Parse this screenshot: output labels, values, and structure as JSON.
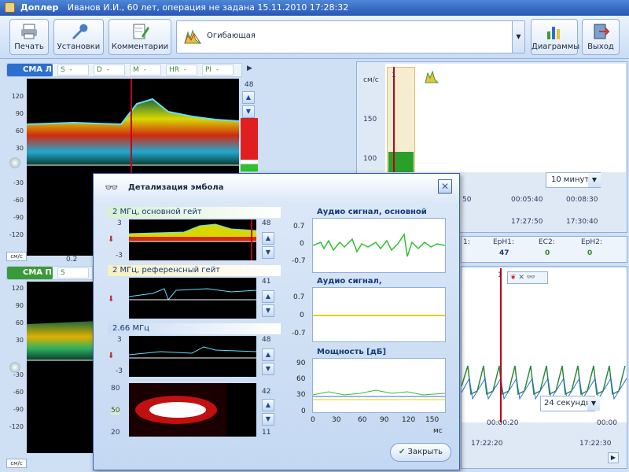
{
  "window": {
    "app_name": "Доплер",
    "title_rest": "Иванов И.И., 60 лет, операция не задана   15.11.2010 17:28:32"
  },
  "toolbar": {
    "print": "Печать",
    "settings": "Установки",
    "comments": "Комментарии",
    "diagrams": "Диаграммы",
    "exit": "Выход",
    "envelope_value": "Огибающая"
  },
  "channel_top": {
    "name": "СМА Л",
    "fields": [
      {
        "label": "S",
        "value": "-"
      },
      {
        "label": "D",
        "value": "-"
      },
      {
        "label": "M",
        "value": "-"
      },
      {
        "label": "HR",
        "value": "-"
      },
      {
        "label": "PI",
        "value": "-"
      }
    ],
    "scale_top": "48",
    "y_ticks": [
      "120",
      "90",
      "60",
      "30",
      "0",
      "-30",
      "-60",
      "-90",
      "-120"
    ],
    "x_tick": "0.2",
    "unit": "см/с"
  },
  "channel_bottom": {
    "name": "СМА П",
    "field_label": "S",
    "y_ticks": [
      "120",
      "90",
      "60",
      "30",
      "0",
      "-30",
      "-60",
      "-90",
      "-120"
    ],
    "unit": "см/с"
  },
  "trend_top": {
    "unit": "см/с",
    "y_ticks": [
      "150",
      "100"
    ],
    "marker": "1",
    "period": "10 минут",
    "times_row1": [
      "50",
      "00:05:40",
      "00:08:30"
    ],
    "times_row2": [
      "17:27:50",
      "17:30:40"
    ]
  },
  "stats": [
    {
      "label": "1:",
      "value": ""
    },
    {
      "label": "EpH1:",
      "value": "47"
    },
    {
      "label": "EC2:",
      "value": "0"
    },
    {
      "label": "EpH2:",
      "value": "0"
    }
  ],
  "trend_bottom": {
    "marker": "1",
    "period": "24 секунды",
    "times_row1": [
      "00:00:20",
      "00:00"
    ],
    "times_row2": [
      "17:22:20",
      "17:22:30"
    ]
  },
  "dialog": {
    "title": "Детализация эмбола",
    "sec1": "2 МГц, основной гейт",
    "sec1_scale": "48",
    "sec1_ticks": [
      "3",
      "-3"
    ],
    "sec2": "2 МГц, референсный гейт",
    "sec2_scale": "41",
    "sec3": "2.66 МГц",
    "sec3_scale": "48",
    "sec3_ticks": [
      "3",
      "-3"
    ],
    "sec4_ticks": [
      "80",
      "50",
      "20"
    ],
    "sec4_scale_top": "42",
    "sec4_scale_bottom": "11",
    "audio_main": "Аудио сигнал, основной гейт",
    "audio_main_ticks": [
      "0.7",
      "0",
      "-0.7"
    ],
    "audio_ref": "Аудио сигнал, референсный ге...",
    "audio_ref_ticks": [
      "0.7",
      "0",
      "-0.7"
    ],
    "power": "Мощность [дБ]",
    "power_ticks": [
      "90",
      "60",
      "30",
      "0"
    ],
    "power_x": [
      "0",
      "30",
      "60",
      "90",
      "120",
      "150"
    ],
    "power_x_unit": "мс",
    "close_label": "Закрыть"
  },
  "colors": {
    "accent": "#2757b5",
    "green_tag": "#3a9a3a",
    "blue_tag": "#2d6fd1",
    "marker": "#c0001a"
  }
}
